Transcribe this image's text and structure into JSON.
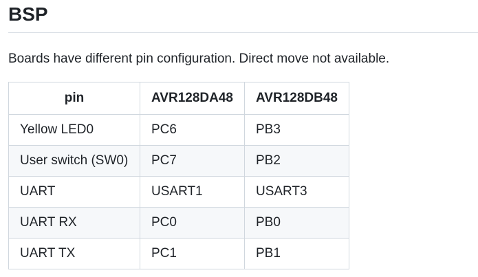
{
  "heading": "BSP",
  "paragraph": "Boards have different pin configuration. Direct move not available.",
  "table": {
    "headers": [
      "pin",
      "AVR128DA48",
      "AVR128DB48"
    ],
    "rows": [
      [
        "Yellow LED0",
        "PC6",
        "PB3"
      ],
      [
        "User switch (SW0)",
        "PC7",
        "PB2"
      ],
      [
        "UART",
        "USART1",
        "USART3"
      ],
      [
        "UART RX",
        "PC0",
        "PB0"
      ],
      [
        "UART TX",
        "PC1",
        "PB1"
      ]
    ]
  },
  "colors": {
    "border": "#d0d7de",
    "stripe": "#f6f8fa",
    "text": "#1f2328"
  }
}
